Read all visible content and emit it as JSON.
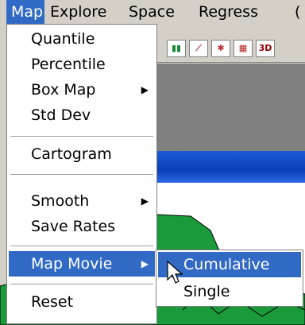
{
  "menubar": {
    "items": [
      "Map",
      "Explore",
      "Space",
      "Regress",
      "("
    ]
  },
  "toolbar": {
    "buttons": [
      {
        "icon": "bar-chart-icon",
        "glyph": "▮▮"
      },
      {
        "icon": "line-plot-icon",
        "glyph": "⟋"
      },
      {
        "icon": "scatter-matrix-icon",
        "glyph": "✱"
      },
      {
        "icon": "grid-plot-icon",
        "glyph": "▦"
      },
      {
        "icon": "3d-plot-icon",
        "glyph": "3D"
      }
    ]
  },
  "map_menu": {
    "items": [
      {
        "label": "Quantile"
      },
      {
        "label": "Percentile"
      },
      {
        "label": "Box Map",
        "submenu_arrow": "▶"
      },
      {
        "label": "Std Dev"
      },
      {
        "label": "Cartogram"
      },
      {
        "label": "Smooth",
        "submenu_arrow": "▶"
      },
      {
        "label": "Save Rates"
      },
      {
        "label": "Map Movie",
        "submenu_arrow": "▶"
      },
      {
        "label": "Reset"
      }
    ]
  },
  "map_movie_submenu": {
    "items": [
      {
        "label": "Cumulative"
      },
      {
        "label": "Single"
      }
    ]
  },
  "colors": {
    "menu_highlight": "#316ac5",
    "menu_background": "#ffffff",
    "window_background": "#d4d0c8",
    "map_fill": "#1a9a3a"
  }
}
